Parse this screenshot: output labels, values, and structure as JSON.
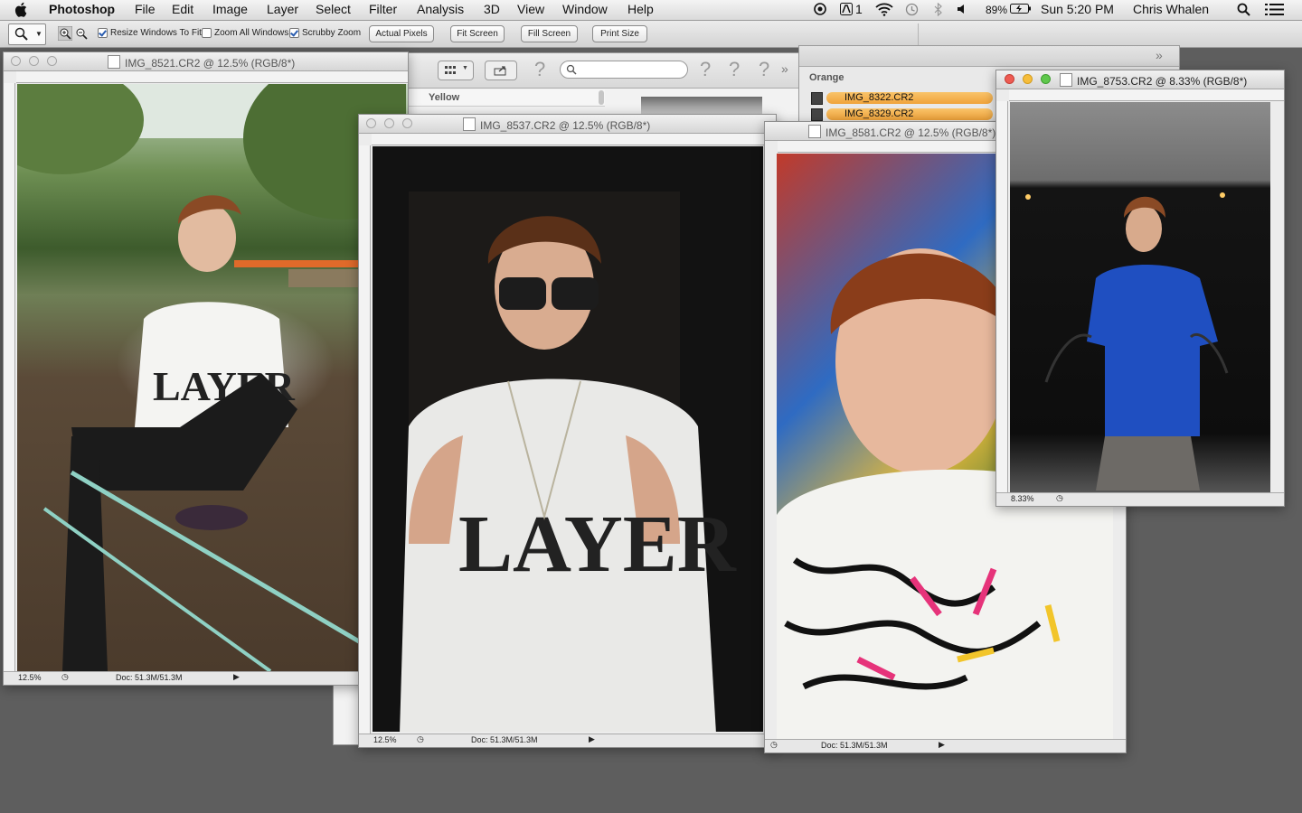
{
  "menubar": {
    "app": "Photoshop",
    "items": [
      "File",
      "Edit",
      "Image",
      "Layer",
      "Select",
      "Filter",
      "Analysis",
      "3D",
      "View",
      "Window",
      "Help"
    ],
    "status": {
      "adobe_count": "1",
      "battery": "89%",
      "clock": "Sun 5:20 PM",
      "user": "Chris Whalen"
    }
  },
  "options": {
    "resize_windows": "Resize Windows To Fit",
    "zoom_all": "Zoom All Windows",
    "scrubby": "Scrubby Zoom",
    "actual_pixels": "Actual Pixels",
    "fit_screen": "Fit Screen",
    "fill_screen": "Fill Screen",
    "print_size": "Print Size"
  },
  "bridge": {
    "label_yellow": "Yellow",
    "label_orange": "Orange",
    "files": [
      "IMG_8322.CR2",
      "IMG_8329.CR2"
    ]
  },
  "windows": [
    {
      "title": "IMG_8521.CR2 @ 12.5% (RGB/8*)",
      "zoom": "12.5%",
      "doc": "Doc: 51.3M/51.3M"
    },
    {
      "title": "IMG_8537.CR2 @ 12.5% (RGB/8*)",
      "zoom": "12.5%",
      "doc": "Doc: 51.3M/51.3M"
    },
    {
      "title": "IMG_8581.CR2 @ 12.5% (RGB/8*)",
      "zoom": "12.5%",
      "doc": "Doc: 51.3M/51.3M"
    },
    {
      "title": "IMG_8753.CR2 @ 8.33% (RGB/8*)",
      "zoom": "8.33%"
    }
  ],
  "colors": {
    "highlight": "#f0a33a",
    "desktop": "#5e5e5e"
  }
}
